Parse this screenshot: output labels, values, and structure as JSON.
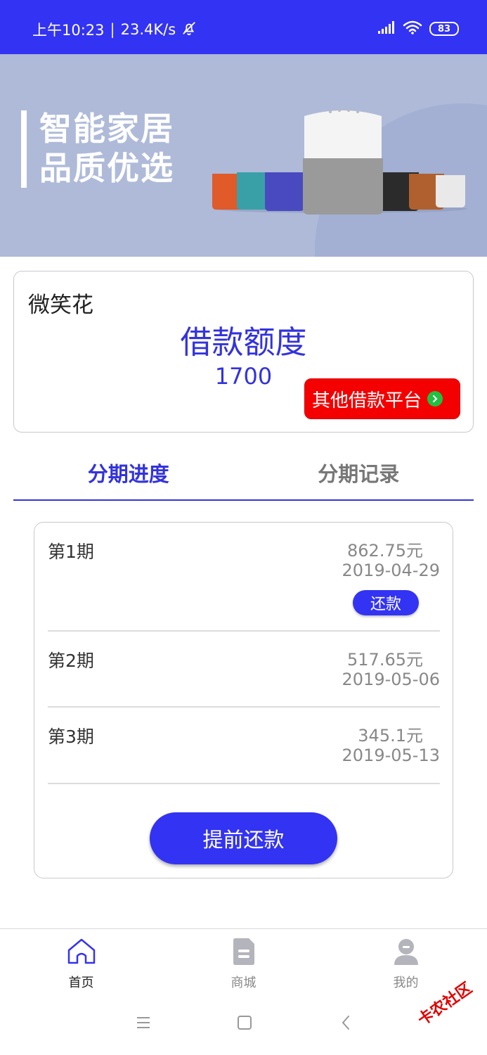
{
  "status_bar": {
    "time": "上午10:23",
    "separator": "|",
    "network_speed": "23.4K/s",
    "battery": "83",
    "bg_color": "#3333f3"
  },
  "banner": {
    "title_line1": "智能家居",
    "title_line2": "品质优选"
  },
  "quota_card": {
    "app_name": "微笑花",
    "label": "借款额度",
    "value": "1700",
    "other_platform_label": "其他借款平台"
  },
  "tabs": [
    {
      "label": "分期进度",
      "active": true
    },
    {
      "label": "分期记录",
      "active": false
    }
  ],
  "installments": [
    {
      "period": "第1期",
      "amount": "862.75元",
      "date": "2019-04-29",
      "action": "还款"
    },
    {
      "period": "第2期",
      "amount": "517.65元",
      "date": "2019-05-06"
    },
    {
      "period": "第3期",
      "amount": "345.1元",
      "date": "2019-05-13"
    }
  ],
  "prepay_label": "提前还款",
  "bottom_nav": [
    {
      "label": "首页",
      "icon": "home-icon",
      "active": true
    },
    {
      "label": "商城",
      "icon": "document-icon",
      "active": false
    },
    {
      "label": "我的",
      "icon": "user-icon",
      "active": false
    }
  ],
  "watermark": "卡农社区",
  "colors": {
    "accent": "#3333f3",
    "danger": "#f50000",
    "banner_bg": "#aebad8"
  }
}
